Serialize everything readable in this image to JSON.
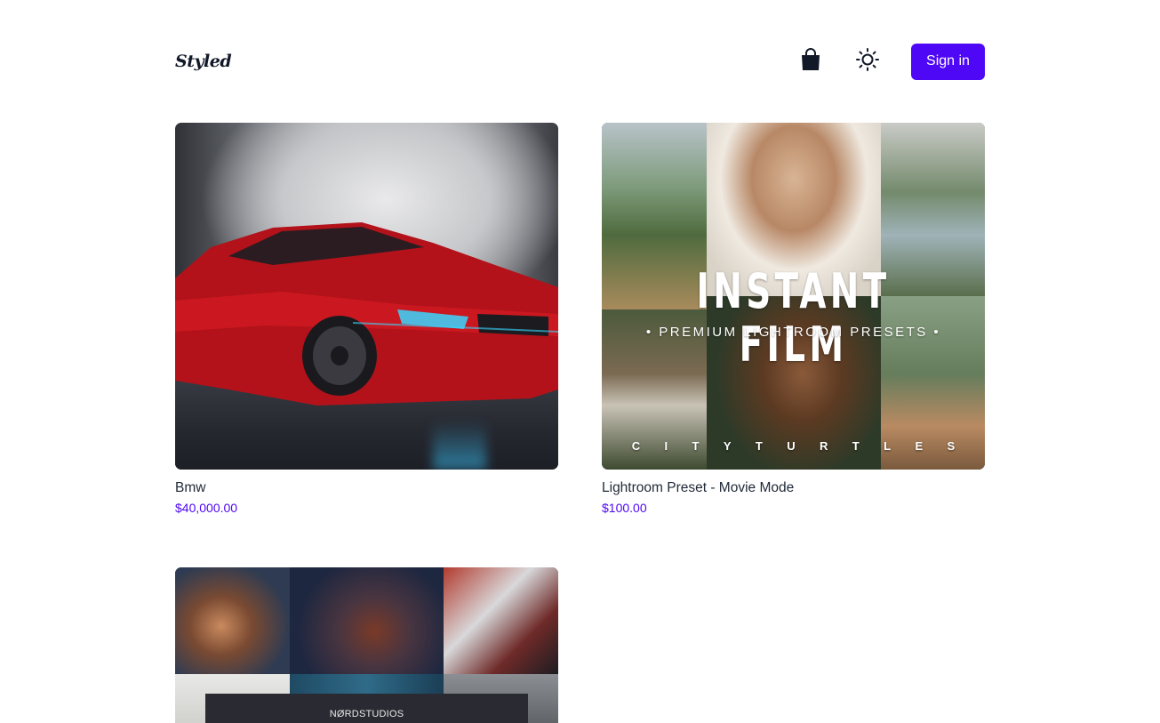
{
  "header": {
    "brand": "Styled",
    "sign_in_label": "Sign in",
    "cart_icon": "shopping-bag-icon",
    "theme_icon": "sun-icon",
    "accent_color": "#4f08f5"
  },
  "products": [
    {
      "name": "Bmw",
      "price": "$40,000.00",
      "image": "red-bmw-sports-car"
    },
    {
      "name": "Lightroom Preset - Movie Mode",
      "price": "$100.00",
      "image": "instant-film-preset-collage",
      "image_text": {
        "title": "INSTANT FILM",
        "subtitle": "• PREMIUM LIGHTROOM PRESETS •",
        "credit": [
          "C",
          "I",
          "T",
          "Y",
          "T",
          "U",
          "R",
          "T",
          "L",
          "E",
          "S"
        ]
      }
    },
    {
      "name": "",
      "price": "",
      "image": "nordstudios-preset-collage",
      "image_text": {
        "banner": "NØRDSTUDIOS"
      }
    }
  ]
}
